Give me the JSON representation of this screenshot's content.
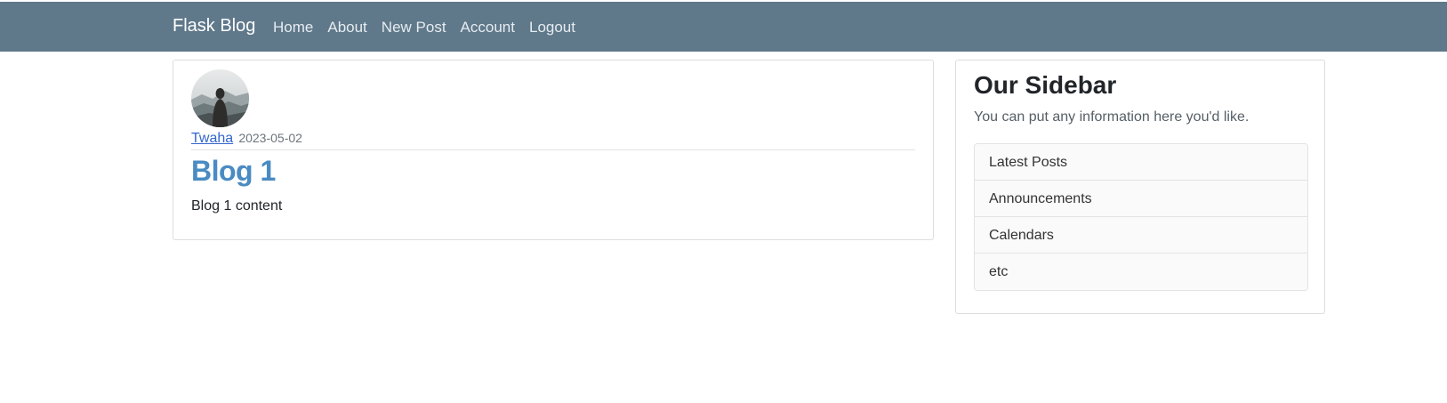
{
  "navbar": {
    "brand": "Flask Blog",
    "links": [
      {
        "label": "Home"
      },
      {
        "label": "About"
      },
      {
        "label": "New Post"
      },
      {
        "label": "Account"
      },
      {
        "label": "Logout"
      }
    ],
    "background": "#5f788a"
  },
  "post": {
    "author": "Twaha",
    "date": "2023-05-02",
    "title": "Blog 1",
    "content": "Blog 1 content",
    "title_color": "#4a8bc2",
    "avatar_icon": "profile-photo"
  },
  "sidebar": {
    "title": "Our Sidebar",
    "description": "You can put any information here you'd like.",
    "items": [
      {
        "label": "Latest Posts"
      },
      {
        "label": "Announcements"
      },
      {
        "label": "Calendars"
      },
      {
        "label": "etc"
      }
    ]
  }
}
